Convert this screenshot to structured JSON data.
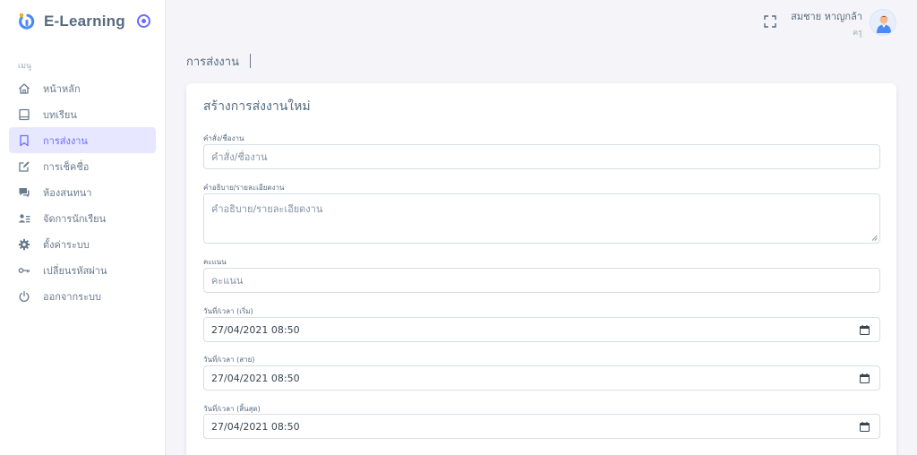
{
  "brand": {
    "name": "E-Learning"
  },
  "sidebar": {
    "header": "เมนู",
    "items": [
      {
        "label": "หน้าหลัก",
        "icon": "home-icon"
      },
      {
        "label": "บทเรียน",
        "icon": "book-icon"
      },
      {
        "label": "การส่งงาน",
        "icon": "bookmark-icon",
        "active": true
      },
      {
        "label": "การเช็คชื่อ",
        "icon": "edit-icon"
      },
      {
        "label": "ห้องสนทนา",
        "icon": "chat-icon"
      },
      {
        "label": "จัดการนักเรียน",
        "icon": "user-list-icon"
      },
      {
        "label": "ตั้งค่าระบบ",
        "icon": "gear-icon"
      },
      {
        "label": "เปลี่ยนรหัสผ่าน",
        "icon": "key-icon"
      },
      {
        "label": "ออกจากระบบ",
        "icon": "power-icon"
      }
    ]
  },
  "navbar": {
    "user_name": "สมชาย หาญกล้า",
    "user_role": "ครู"
  },
  "page": {
    "title": "การส่งงาน"
  },
  "form": {
    "title": "สร้างการส่งงานใหม่",
    "name_label": "คำสั่ง/ชื่องาน",
    "name_placeholder": "คำสั่ง/ชื่องาน",
    "desc_label": "คำอธิบาย/รายละเอียดงาน",
    "desc_placeholder": "คำอธิบาย/รายละเอียดงาน",
    "score_label": "คะแนน",
    "score_placeholder": "คะแนน",
    "start_label": "วันที่/เวลา (เริ่ม)",
    "start_value": "27/04/2021 08:50",
    "late_label": "วันที่/เวลา (สาย)",
    "late_value": "27/04/2021 08:50",
    "end_label": "วันที่/เวลา (สิ้นสุด)",
    "end_value": "27/04/2021 08:50"
  },
  "colors": {
    "accent": "#696cff",
    "active_bg": "#e7e7ff",
    "brand_logo": "#4c8bf5",
    "brand_logo_dot": "#f5a623"
  }
}
